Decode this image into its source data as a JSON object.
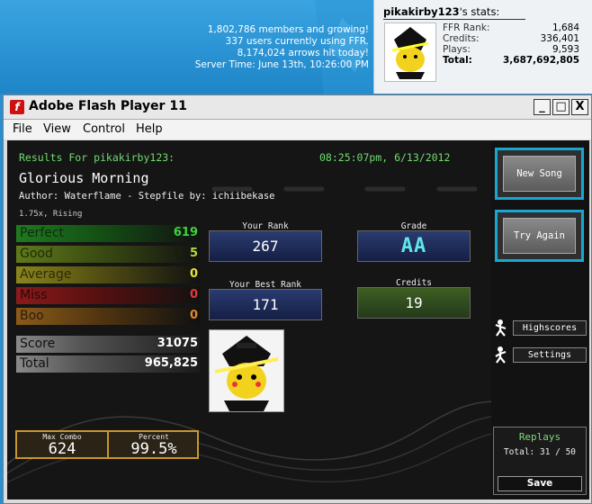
{
  "site": {
    "lines": [
      "1,802,786 members and growing!",
      "337 users currently using FFR.",
      "8,174,024 arrows hit today!",
      "Server Time: June 13th, 10:26:00 PM"
    ]
  },
  "user_panel": {
    "username": "pikakirby123",
    "title_suffix": "'s stats:",
    "stats": [
      {
        "label": "FFR Rank:",
        "value": "1,684"
      },
      {
        "label": "Credits:",
        "value": "336,401"
      },
      {
        "label": "Plays:",
        "value": "9,593"
      },
      {
        "label": "Total:",
        "value": "3,687,692,805"
      }
    ]
  },
  "window": {
    "title": "Adobe Flash Player 11",
    "app_icon_glyph": "f",
    "buttons": {
      "minimize": "_",
      "maximize": "□",
      "close": "X"
    },
    "menu": [
      "File",
      "View",
      "Control",
      "Help"
    ]
  },
  "results": {
    "results_for": "Results For pikakirby123:",
    "timestamp": "08:25:07pm, 6/13/2012",
    "song_title": "Glorious Morning",
    "author_line": "Author: Waterflame  -  Stepfile by: ichiibekase",
    "speed": "1.75x, Rising",
    "judgements": [
      {
        "label": "Perfect",
        "value": "619",
        "color": "#3fd23f"
      },
      {
        "label": "Good",
        "value": "5",
        "color": "#b6d83a"
      },
      {
        "label": "Average",
        "value": "0",
        "color": "#e7e23a"
      },
      {
        "label": "Miss",
        "value": "0",
        "color": "#e03a3a"
      },
      {
        "label": "Boo",
        "value": "0",
        "color": "#e08a2a"
      }
    ],
    "score_label": "Score",
    "score_value": "31075",
    "total_label": "Total",
    "total_value": "965,825",
    "max_combo_label": "Max Combo",
    "max_combo_value": "624",
    "percent_label": "Percent",
    "percent_value": "99.5%",
    "your_rank_label": "Your Rank",
    "your_rank_value": "267",
    "grade_label": "Grade",
    "grade_value": "AA",
    "best_rank_label": "Your Best Rank",
    "best_rank_value": "171",
    "credits_label": "Credits",
    "credits_value": "19"
  },
  "sidebar": {
    "new_song": "New Song",
    "try_again": "Try Again",
    "highscores": "Highscores",
    "settings": "Settings",
    "replays_title": "Replays",
    "replays_total": "Total: 31 / 50",
    "save": "Save"
  },
  "colors": {
    "accent_cyan": "#19a7cf",
    "header_green": "#6fdc6f",
    "combo_border": "#c9962c"
  }
}
